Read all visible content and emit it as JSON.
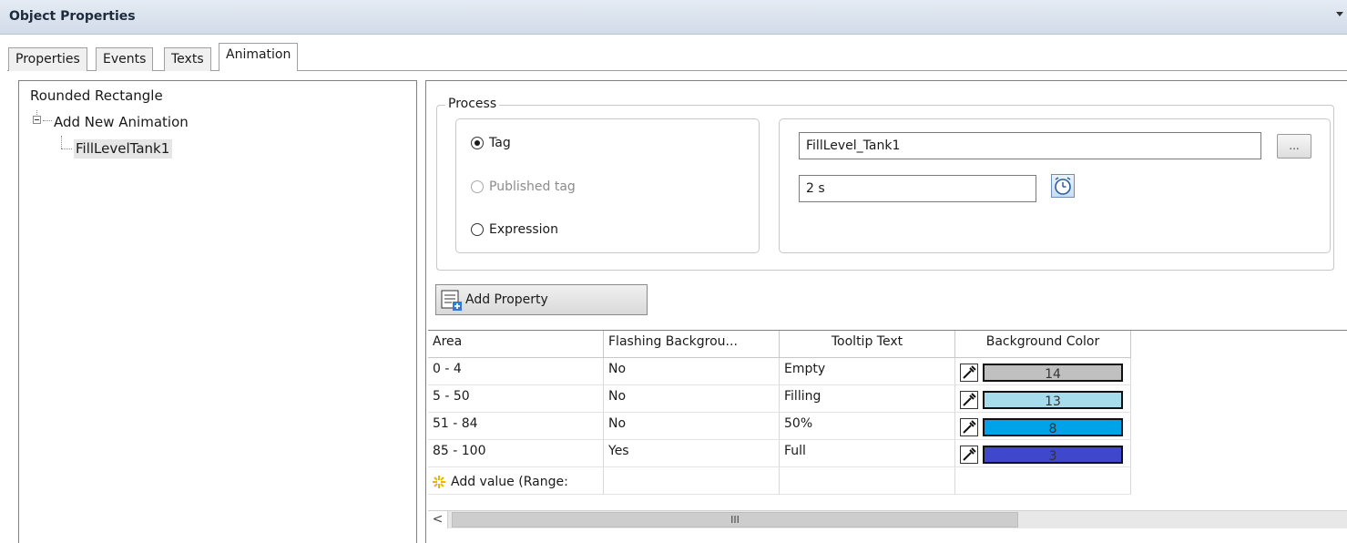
{
  "window": {
    "title": "Object Properties"
  },
  "tabs": [
    {
      "label": "Properties"
    },
    {
      "label": "Events"
    },
    {
      "label": "Texts"
    },
    {
      "label": "Animation",
      "active": true
    }
  ],
  "tree": {
    "root": "Rounded Rectangle",
    "node": "Add New Animation",
    "child": "FillLevelTank1"
  },
  "process": {
    "legend": "Process",
    "options": [
      {
        "label": "Tag",
        "selected": true,
        "enabled": true
      },
      {
        "label": "Published tag",
        "selected": false,
        "enabled": false
      },
      {
        "label": "Expression",
        "selected": false,
        "enabled": true
      }
    ],
    "tag_value": "FillLevel_Tank1",
    "browse_label": "...",
    "cycle_value": "2 s"
  },
  "add_property_label": "Add Property",
  "grid": {
    "headers": [
      "Area",
      "Flashing Backgrou...",
      "Tooltip Text",
      "Background Color"
    ],
    "rows": [
      {
        "area": "0 - 4",
        "flashing": "No",
        "tooltip": "Empty",
        "color_index": "14",
        "color": "#c0c0c0"
      },
      {
        "area": "5 - 50",
        "flashing": "No",
        "tooltip": "Filling",
        "color_index": "13",
        "color": "#a6dcec"
      },
      {
        "area": "51 - 84",
        "flashing": "No",
        "tooltip": "50%",
        "color_index": "8",
        "color": "#00a2e8"
      },
      {
        "area": "85 - 100",
        "flashing": "Yes",
        "tooltip": "Full",
        "color_index": "3",
        "color": "#3f48cc"
      }
    ],
    "add_value": "Add value (Range:"
  },
  "scrollbar": {
    "left_arrow": "<",
    "thumb_grip": "III"
  },
  "colors": {
    "accent": "#1e2b3c",
    "title_bg": "#d8e1ec"
  }
}
